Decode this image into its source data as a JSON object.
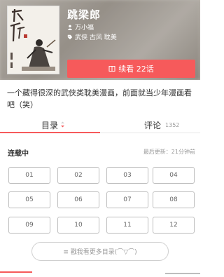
{
  "comic": {
    "title": "跳梁郎",
    "author": "万小福",
    "tags": "武侠 古风 耽美",
    "description": "一个藏得很深的武侠类耽美漫画，前面就当少年漫画看吧（笑）"
  },
  "actions": {
    "continue_label": "续看 22话"
  },
  "tabs": {
    "catalog_label": "目录",
    "comments_label": "评论",
    "comments_count": "1352"
  },
  "catalog": {
    "status": "连载中",
    "last_update": "最后更新：21分钟前",
    "chapters": [
      "01",
      "02",
      "03",
      "04",
      "05",
      "06",
      "07",
      "08",
      "09",
      "10",
      "11",
      "12"
    ],
    "more_label": "≡ 戳我看更多目录(⌒▽⌒)"
  },
  "colors": {
    "accent": "#f65a5b"
  }
}
